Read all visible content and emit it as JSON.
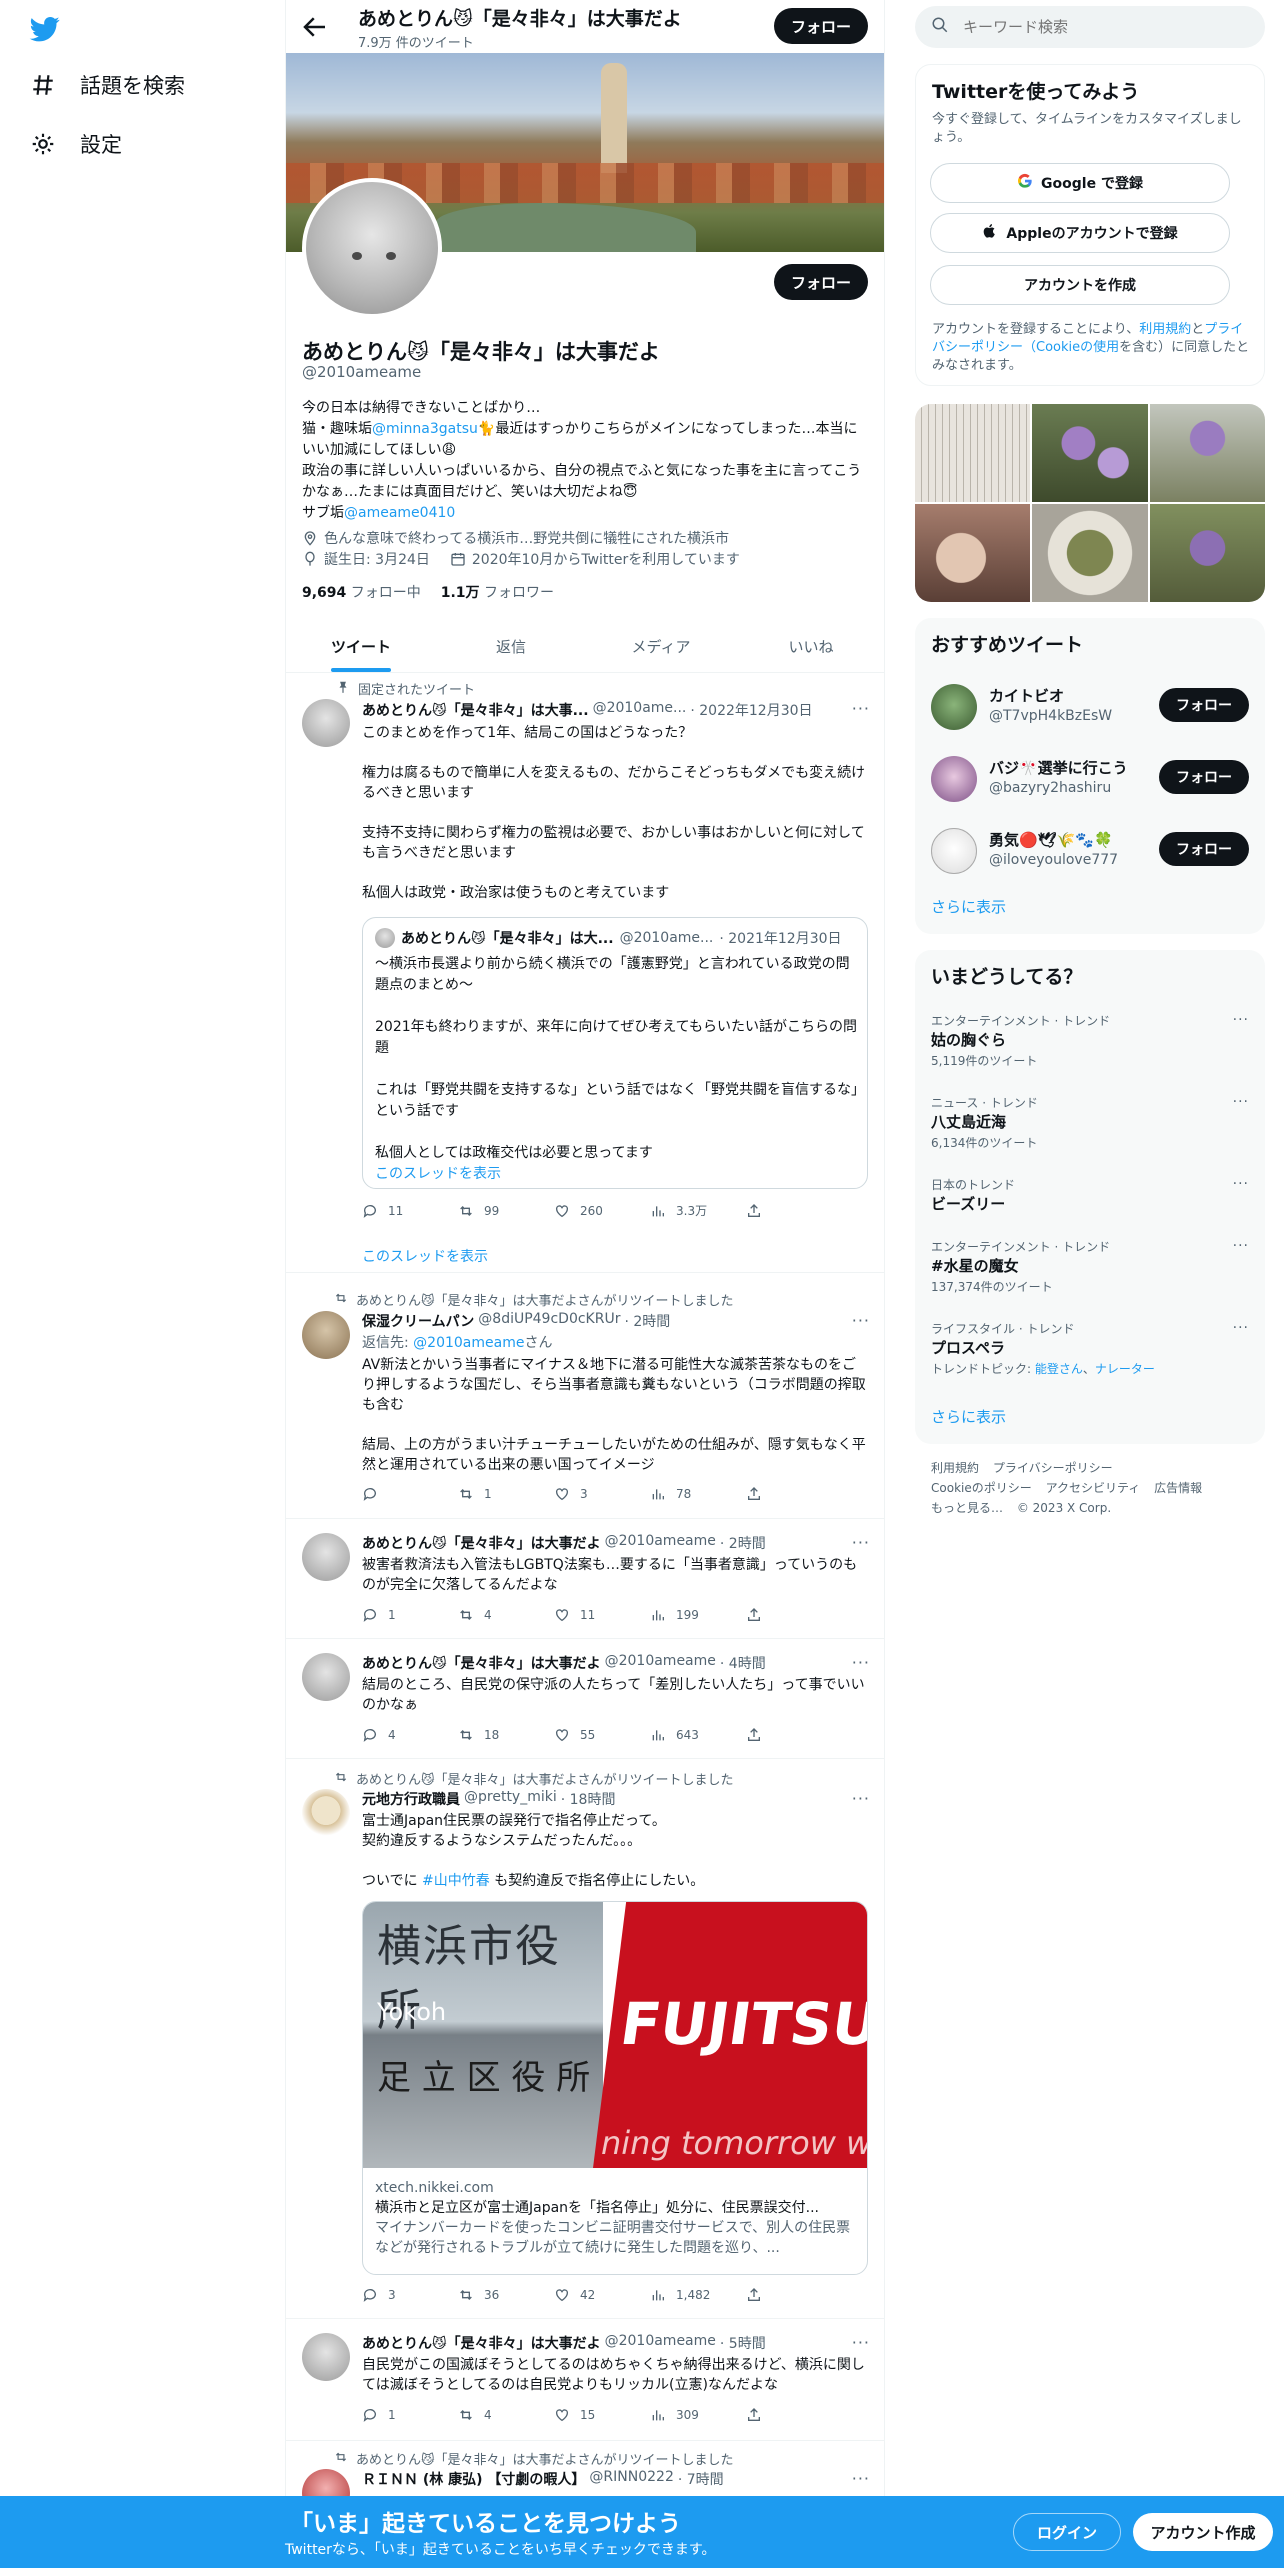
{
  "nav": {
    "items": [
      {
        "label": "話題を検索",
        "icon": "hashtag-icon"
      },
      {
        "label": "設定",
        "icon": "gear-icon"
      }
    ]
  },
  "header": {
    "name": "あめとりん😼「是々非々」は大事だよ",
    "tweet_count": "7.9万 件のツイート",
    "follow_label": "フォロー"
  },
  "profile": {
    "name": "あめとりん😼「是々非々」は大事だよ",
    "handle": "@2010ameame",
    "follow_label": "フォロー",
    "bio": {
      "line1": "今の日本は納得できないことばかり…",
      "line2_pre": "猫・趣味垢",
      "line2_link": "@minna3gatsu",
      "line2_post": "🐈最近はすっかりこちらがメインになってしまった…本当にいい加減にしてほしい😩",
      "line3": "政治の事に詳しい人いっぱいいるから、自分の視点でふと気になった事を主に言ってこうかなぁ…たまには真面目だけど、笑いは大切だよね😇",
      "line4_pre": "サブ垢",
      "line4_link": "@ameame0410"
    },
    "location": "色んな意味で終わってる横浜市…野党共倒に犠牲にされた横浜市",
    "birthday": "誕生日: 3月24日",
    "joined": "2020年10月からTwitterを利用しています",
    "following_count": "9,694",
    "following_label": "フォロー中",
    "followers_count": "1.1万",
    "followers_label": "フォロワー"
  },
  "tabs": [
    {
      "label": "ツイート",
      "active": true
    },
    {
      "label": "返信",
      "active": false
    },
    {
      "label": "メディア",
      "active": false
    },
    {
      "label": "いいね",
      "active": false
    }
  ],
  "tweets": {
    "t1": {
      "context": "固定されたツイート",
      "name": "あめとりん😼「是々非々」は大事...",
      "handle": "@2010ame...",
      "time": "· 2022年12月30日",
      "lines": [
        "このまとめを作って1年、結局この国はどうなった？",
        "",
        "権力は腐るもので簡単に人を変えるもの、だからこそどっちもダメでも変え続けるべきと思います",
        "",
        "支持不支持に関わらず権力の監視は必要で、おかしい事はおかしいと何に対しても言うべきだと思います",
        "",
        "私個人は政党・政治家は使うものと考えています"
      ],
      "quote": {
        "name": "あめとりん😼「是々非々」は大...",
        "handle": "@2010ame...",
        "time": "· 2021年12月30日",
        "lines": [
          "〜横浜市長選より前から続く横浜での「護憲野党」と言われている政党の問題点のまとめ〜",
          "",
          "2021年も終わりますが、来年に向けてぜひ考えてもらいたい話がこちらの問題",
          "",
          "これは「野党共闘を支持するな」という話ではなく「野党共闘を盲信するな」という話です",
          "",
          "私個人としては政権交代は必要と思ってます"
        ],
        "thread": "このスレッドを表示"
      },
      "replies": "11",
      "retweets": "99",
      "likes": "260",
      "views": "3.3万",
      "thread": "このスレッドを表示"
    },
    "t2": {
      "context": "あめとりん😼「是々非々」は大事だよさんがリツイートしました",
      "name": "保湿クリームパン",
      "handle": "@8diUP49cD0cKRUr",
      "time": "· 2時間",
      "reply_to_pre": "返信先: ",
      "reply_to_link": "@2010ameame",
      "reply_to_post": "さん",
      "lines": [
        "AV新法とかいう当事者にマイナス＆地下に潜る可能性大な滅茶苦茶なものをごり押しするような国だし、そら当事者意識も糞もないという（コラボ問題の搾取も含む",
        "",
        "結局、上の方がうまい汁チューチューしたいがための仕組みが、隠す気もなく平然と運用されている出来の悪い国ってイメージ"
      ],
      "replies": "",
      "retweets": "1",
      "likes": "3",
      "views": "78"
    },
    "t3": {
      "name": "あめとりん😼「是々非々」は大事だよ",
      "handle": "@2010ameame",
      "time": "· 2時間",
      "lines": [
        "被害者救済法も入管法もLGBTQ法案も…要するに「当事者意識」っていうのものが完全に欠落してるんだよな"
      ],
      "replies": "1",
      "retweets": "4",
      "likes": "11",
      "views": "199"
    },
    "t4": {
      "name": "あめとりん😼「是々非々」は大事だよ",
      "handle": "@2010ameame",
      "time": "· 4時間",
      "lines": [
        "結局のところ、自民党の保守派の人たちって「差別したい人たち」って事でいいのかなぁ"
      ],
      "replies": "4",
      "retweets": "18",
      "likes": "55",
      "views": "643"
    },
    "t5": {
      "context": "あめとりん😼「是々非々」は大事だよさんがリツイートしました",
      "name": "元地方行政職員",
      "handle": "@pretty_miki",
      "time": "· 18時間",
      "lines": [
        "富士通Japan住民票の誤発行で指名停止だって。",
        "契約違反するようなシステムだったんだ。。。",
        ""
      ],
      "last_pre": "ついでに ",
      "last_link": "#山中竹春",
      "last_post": " も契約違反で指名停止にしたい。",
      "card": {
        "img_text_1": "横浜市役所",
        "img_text_2": "Yokoh",
        "img_text_3": "足 立 区 役 所",
        "img_text_4": "FUJITSU",
        "img_text_5": "ning tomorrow with",
        "domain": "xtech.nikkei.com",
        "title": "横浜市と足立区が富士通Japanを「指名停止」処分に、住民票誤交付...",
        "desc": "マイナンバーカードを使ったコンビニ証明書交付サービスで、別人の住民票などが発行されるトラブルが立て続けに発生した問題を巡り、..."
      },
      "replies": "3",
      "retweets": "36",
      "likes": "42",
      "views": "1,482"
    },
    "t6": {
      "name": "あめとりん😼「是々非々」は大事だよ",
      "handle": "@2010ameame",
      "time": "· 5時間",
      "lines": [
        "自民党がこの国滅ぼそうとしてるのはめちゃくちゃ納得出来るけど、横浜に関しては滅ぼそうとしてるのは自民党よりもリッカル(立憲)なんだよな"
      ],
      "replies": "1",
      "retweets": "4",
      "likes": "15",
      "views": "309"
    },
    "t7": {
      "context": "あめとりん😼「是々非々」は大事だよさんがリツイートしました",
      "name": "ＲＩＮＮ (林 康弘) 【寸劇の暇人】",
      "handle": "@RINN0222",
      "time": "· 7時間"
    }
  },
  "sidebar": {
    "search_placeholder": "キーワード検索",
    "signup": {
      "title": "Twitterを使ってみよう",
      "sub": "今すぐ登録して、タイムラインをカスタマイズしましょう。",
      "google": "Google で登録",
      "apple": "Appleのアカウントで登録",
      "create": "アカウントを作成",
      "legal_pre": "アカウントを登録することにより、",
      "legal_terms": "利用規約",
      "legal_and": "と",
      "legal_privacy": "プライバシーポリシー",
      "legal_cookie": "（Cookieの使用",
      "legal_post": "を含む）に同意したとみなされます。"
    },
    "recommend": {
      "title": "おすすめツイート",
      "accounts": [
        {
          "name": "カイトビオ",
          "handle": "@T7vpH4kBzEsW",
          "follow": "フォロー"
        },
        {
          "name": "バジ🎌選挙に行こう",
          "handle": "@bazyry2hashiru",
          "follow": "フォロー"
        },
        {
          "name": "勇気🔴🕊🌾🐾🍀",
          "handle": "@iloveyoulove777",
          "follow": "フォロー"
        }
      ],
      "more": "さらに表示"
    },
    "trends": {
      "title": "いまどうしてる？",
      "items": [
        {
          "cat": "エンターテインメント · トレンド",
          "name": "姑の胸ぐら",
          "count": "5,119件のツイート"
        },
        {
          "cat": "ニュース · トレンド",
          "name": "八丈島近海",
          "count": "6,134件のツイート"
        },
        {
          "cat": "日本のトレンド",
          "name": "ビーズリー",
          "count": ""
        },
        {
          "cat": "エンターテインメント · トレンド",
          "name": "#水星の魔女",
          "count": "137,374件のツイート"
        },
        {
          "cat": "ライフスタイル · トレンド",
          "name": "プロスペラ",
          "count": "トレンドトピック: ",
          "link1": "能登さん",
          "sep": "、",
          "link2": "ナレーター"
        }
      ],
      "more": "さらに表示"
    },
    "footer": {
      "terms": "利用規約",
      "privacy": "プライバシーポリシー",
      "cookie": "Cookieのポリシー",
      "accessibility": "アクセシビリティ",
      "ads": "広告情報",
      "more": "もっと見る…",
      "copyright": "© 2023 X Corp."
    }
  },
  "bottom": {
    "title": "「いま」起きていることを見つけよう",
    "sub": "Twitterなら、「いま」起きていることをいち早くチェックできます。",
    "login": "ログイン",
    "signup": "アカウント作成"
  },
  "colors": {
    "accent": "#1d9bf0",
    "text": "#0f1419",
    "muted": "#536471",
    "border": "#eff3f4"
  }
}
